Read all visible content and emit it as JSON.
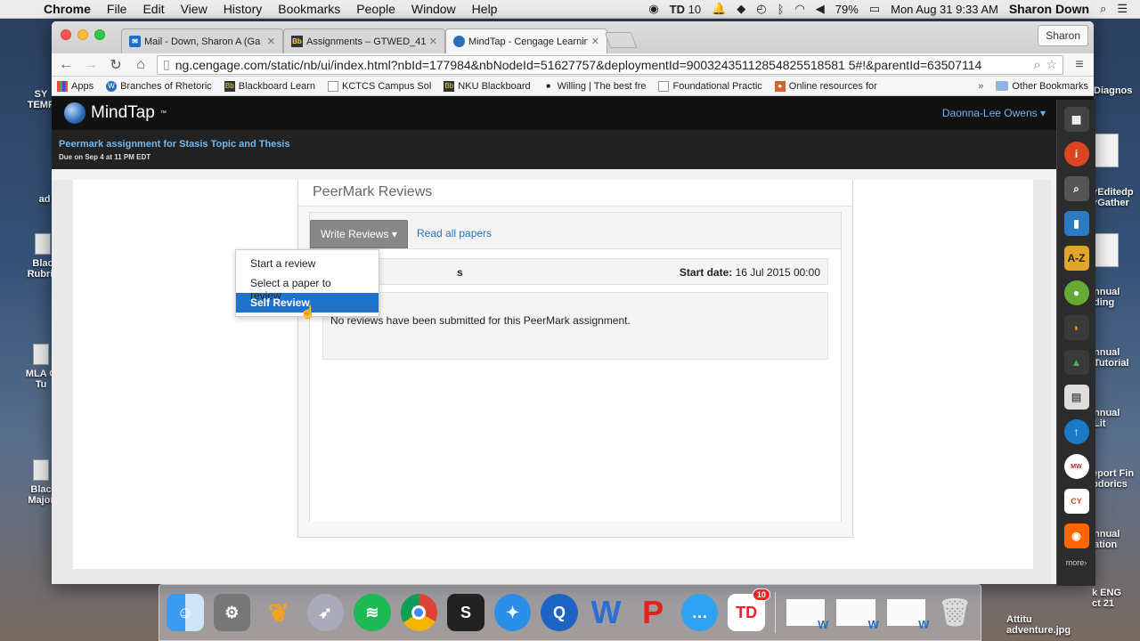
{
  "menubar": {
    "app": "Chrome",
    "items": [
      "File",
      "Edit",
      "View",
      "History",
      "Bookmarks",
      "People",
      "Window",
      "Help"
    ],
    "status": {
      "td_count": "10",
      "battery": "79%",
      "datetime": "Mon Aug 31  9:33 AM",
      "user": "Sharon Down"
    }
  },
  "browser": {
    "tabs": [
      {
        "label": "Mail - Down, Sharon A (Ga"
      },
      {
        "label": "Assignments – GTWED_41"
      },
      {
        "label": "MindTap - Cengage Learnin"
      }
    ],
    "profile": "Sharon",
    "url": "ng.cengage.com/static/nb/ui/index.html?nbId=177984&nbNodeId=51627757&deploymentId=90032435112854825518581 5#!&parentId=63507114",
    "bookmarks": [
      {
        "label": "Apps"
      },
      {
        "label": "Branches of Rhetoric"
      },
      {
        "label": "Blackboard Learn"
      },
      {
        "label": "KCTCS Campus Sol"
      },
      {
        "label": "NKU Blackboard"
      },
      {
        "label": "Willing | The best fre"
      },
      {
        "label": "Foundational Practic"
      },
      {
        "label": "Online resources for"
      }
    ],
    "more_bookmarks": "»",
    "other_bookmarks": "Other Bookmarks"
  },
  "mindtap": {
    "logo": "MindTap",
    "user": "Daonna-Lee Owens",
    "help": "?",
    "activity_title": "Peermark assignment for Stasis Topic and Thesis",
    "activity_due": "Due on Sep 4 at 11 PM EDT",
    "panel_title": "PeerMark Reviews",
    "write_reviews": "Write Reviews",
    "read_all": "Read all papers",
    "partial_heading": "s",
    "start_date_label": "Start date:",
    "start_date_value": "16 Jul 2015 00:00",
    "no_reviews": "No reviews have been submitted for this PeerMark assignment.",
    "dropdown": [
      "Start a review",
      "Select a paper to review",
      "Self Review"
    ]
  },
  "sidebar": {
    "more": "more"
  },
  "desktop_left": [
    {
      "label": "SY\nTEMP"
    },
    {
      "label": "ad"
    },
    {
      "label": "Blac\nRubric"
    },
    {
      "label": "MLA C\nTu"
    },
    {
      "label": "Blac\nMajor"
    }
  ],
  "desktop_right": [
    {
      "label": "Diagnos"
    },
    {
      "label": "rEditedp\nrGather"
    },
    {
      "label": "nnual\nding"
    },
    {
      "label": "nnual\nTutorial"
    },
    {
      "label": "nnual\nLit"
    },
    {
      "label": "eport Fin\nbdorics"
    },
    {
      "label": "nnual\nation"
    },
    {
      "label": "k ENG\nct 21"
    },
    {
      "label": "Attitu\nadventure.jpg"
    }
  ],
  "dock": {
    "td_badge": "10"
  },
  "colors": {
    "mindtap_blue": "#6fb8f2",
    "highlight": "#1f72c9",
    "link": "#2a74b8"
  }
}
